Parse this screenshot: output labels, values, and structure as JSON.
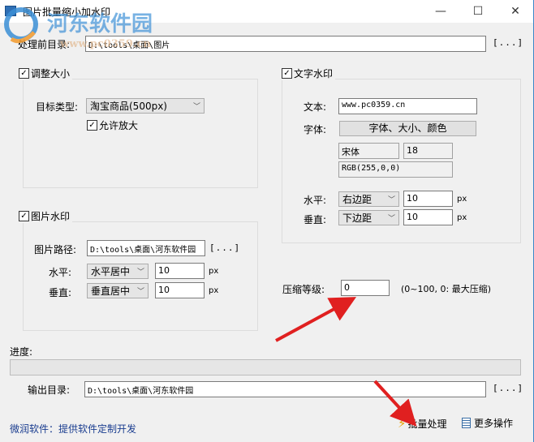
{
  "window": {
    "title": "图片批量缩小加水印",
    "minimize": "—",
    "maximize": "☐",
    "close": "✕"
  },
  "watermark": {
    "logo_text": "河东软件园",
    "logo_url": "www.pc0359.cn"
  },
  "source": {
    "label": "处理前目录:",
    "value": "D:\\tools\\桌面\\图片",
    "browse": "[...]"
  },
  "resize": {
    "label": "调整大小",
    "checked": true,
    "target_label": "目标类型:",
    "target_value": "淘宝商品(500px)",
    "allow_enlarge": "允许放大"
  },
  "image_wm": {
    "label": "图片水印",
    "checked": true,
    "path_label": "图片路径:",
    "path_value": "D:\\tools\\桌面\\河东软件园",
    "browse": "[...]",
    "h_label": "水平:",
    "h_value": "水平居中",
    "h_offset": "10",
    "v_label": "垂直:",
    "v_value": "垂直居中",
    "v_offset": "10",
    "unit": "px"
  },
  "text_wm": {
    "label": "文字水印",
    "checked": true,
    "text_label": "文本:",
    "text_value": "www.pc0359.cn",
    "font_label": "字体:",
    "font_button": "字体、大小、颜色",
    "font_name": "宋体",
    "font_size": "18",
    "color": "RGB(255,0,0)",
    "h_label": "水平:",
    "h_value": "右边距",
    "h_offset": "10",
    "v_label": "垂直:",
    "v_value": "下边距",
    "v_offset": "10",
    "unit": "px"
  },
  "compress": {
    "label": "压缩等级:",
    "value": "0",
    "hint": "(0~100, 0: 最大压缩)"
  },
  "progress": {
    "label": "进度:",
    "value": 0
  },
  "output": {
    "label": "输出目录:",
    "value": "D:\\tools\\桌面\\河东软件园",
    "browse": "[...]"
  },
  "footer": {
    "link": "微润软件：提供软件定制开发",
    "batch": "批量处理",
    "more": "更多操作"
  },
  "colors": {
    "arrow": "#e02020",
    "accent": "#3a87c8",
    "link": "#1a3d8f"
  }
}
